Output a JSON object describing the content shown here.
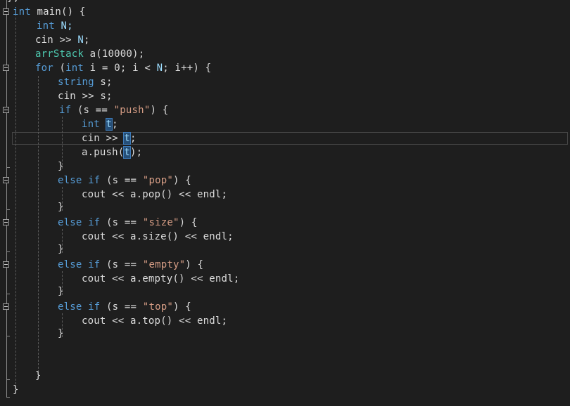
{
  "editor": {
    "language": "C++",
    "lines": [
      {
        "tokens": [
          {
            "t": "}",
            "c": "id"
          },
          {
            "t": ";",
            "c": "id"
          }
        ]
      },
      {
        "tokens": [
          {
            "t": "int",
            "c": "kw"
          },
          {
            "t": " main() {",
            "c": "id"
          }
        ]
      },
      {
        "tokens": [
          {
            "t": "int",
            "c": "kw"
          },
          {
            "t": " N;",
            "c": "var"
          }
        ]
      },
      {
        "tokens": [
          {
            "t": "cin",
            "c": "id"
          },
          {
            "t": " >> ",
            "c": "id"
          },
          {
            "t": "N",
            "c": "var"
          },
          {
            "t": ";",
            "c": "id"
          }
        ]
      },
      {
        "tokens": [
          {
            "t": "arrStack",
            "c": "ty"
          },
          {
            "t": " a(10000);",
            "c": "id"
          }
        ]
      },
      {
        "tokens": [
          {
            "t": "for",
            "c": "kw"
          },
          {
            "t": " (",
            "c": "id"
          },
          {
            "t": "int",
            "c": "kw"
          },
          {
            "t": " i = 0; i < ",
            "c": "id"
          },
          {
            "t": "N",
            "c": "var"
          },
          {
            "t": "; i++) {",
            "c": "id"
          }
        ]
      },
      {
        "tokens": [
          {
            "t": "string",
            "c": "kw"
          },
          {
            "t": " s;",
            "c": "id"
          }
        ]
      },
      {
        "tokens": [
          {
            "t": "cin",
            "c": "id"
          },
          {
            "t": " >> s;",
            "c": "id"
          }
        ]
      },
      {
        "tokens": [
          {
            "t": "if",
            "c": "kw"
          },
          {
            "t": " (s == ",
            "c": "id"
          },
          {
            "t": "\"push\"",
            "c": "str"
          },
          {
            "t": ") {",
            "c": "id"
          }
        ]
      },
      {
        "tokens": [
          {
            "t": "int",
            "c": "kw"
          },
          {
            "t": " ",
            "c": "id"
          },
          {
            "t": "t",
            "c": "var",
            "hl": true
          },
          {
            "t": ";",
            "c": "id"
          }
        ]
      },
      {
        "tokens": [
          {
            "t": "cin",
            "c": "id"
          },
          {
            "t": " >> ",
            "c": "id"
          },
          {
            "t": "t",
            "c": "var",
            "hl": true
          },
          {
            "t": ";",
            "c": "id"
          }
        ]
      },
      {
        "tokens": [
          {
            "t": "a.push(",
            "c": "id"
          },
          {
            "t": "t",
            "c": "var",
            "hl": true
          },
          {
            "t": ");",
            "c": "id"
          }
        ]
      },
      {
        "tokens": [
          {
            "t": "}",
            "c": "id"
          }
        ]
      },
      {
        "tokens": [
          {
            "t": "else if",
            "c": "kw"
          },
          {
            "t": " (s == ",
            "c": "id"
          },
          {
            "t": "\"pop\"",
            "c": "str"
          },
          {
            "t": ") {",
            "c": "id"
          }
        ]
      },
      {
        "tokens": [
          {
            "t": "cout",
            "c": "id"
          },
          {
            "t": " << a.pop() << endl;",
            "c": "id"
          }
        ]
      },
      {
        "tokens": [
          {
            "t": "}",
            "c": "id"
          }
        ]
      },
      {
        "tokens": [
          {
            "t": "else if",
            "c": "kw"
          },
          {
            "t": " (s == ",
            "c": "id"
          },
          {
            "t": "\"size\"",
            "c": "str"
          },
          {
            "t": ") {",
            "c": "id"
          }
        ]
      },
      {
        "tokens": [
          {
            "t": "cout",
            "c": "id"
          },
          {
            "t": " << a.size() << endl;",
            "c": "id"
          }
        ]
      },
      {
        "tokens": [
          {
            "t": "}",
            "c": "id"
          }
        ]
      },
      {
        "tokens": [
          {
            "t": "else if",
            "c": "kw"
          },
          {
            "t": " (s == ",
            "c": "id"
          },
          {
            "t": "\"empty\"",
            "c": "str"
          },
          {
            "t": ") {",
            "c": "id"
          }
        ]
      },
      {
        "tokens": [
          {
            "t": "cout",
            "c": "id"
          },
          {
            "t": " << a.empty() << endl;",
            "c": "id"
          }
        ]
      },
      {
        "tokens": [
          {
            "t": "}",
            "c": "id"
          }
        ]
      },
      {
        "tokens": [
          {
            "t": "else if",
            "c": "kw"
          },
          {
            "t": " (s == ",
            "c": "id"
          },
          {
            "t": "\"top\"",
            "c": "str"
          },
          {
            "t": ") {",
            "c": "id"
          }
        ]
      },
      {
        "tokens": [
          {
            "t": "cout",
            "c": "id"
          },
          {
            "t": " << a.top() << endl;",
            "c": "id"
          }
        ]
      },
      {
        "tokens": [
          {
            "t": "}",
            "c": "id"
          }
        ]
      },
      {
        "tokens": []
      },
      {
        "tokens": []
      },
      {
        "tokens": [
          {
            "t": "}",
            "c": "id"
          }
        ]
      },
      {
        "tokens": [
          {
            "t": "}",
            "c": "id"
          }
        ]
      }
    ],
    "colors": {
      "background": "#1e1e1e",
      "keyword": "#569cd6",
      "type": "#4ec9b0",
      "string": "#d69d85",
      "variable": "#9cdcfe",
      "text": "#dcdcdc",
      "highlight": "#264f78"
    },
    "icons": [
      "fold-collapse-icon"
    ]
  }
}
